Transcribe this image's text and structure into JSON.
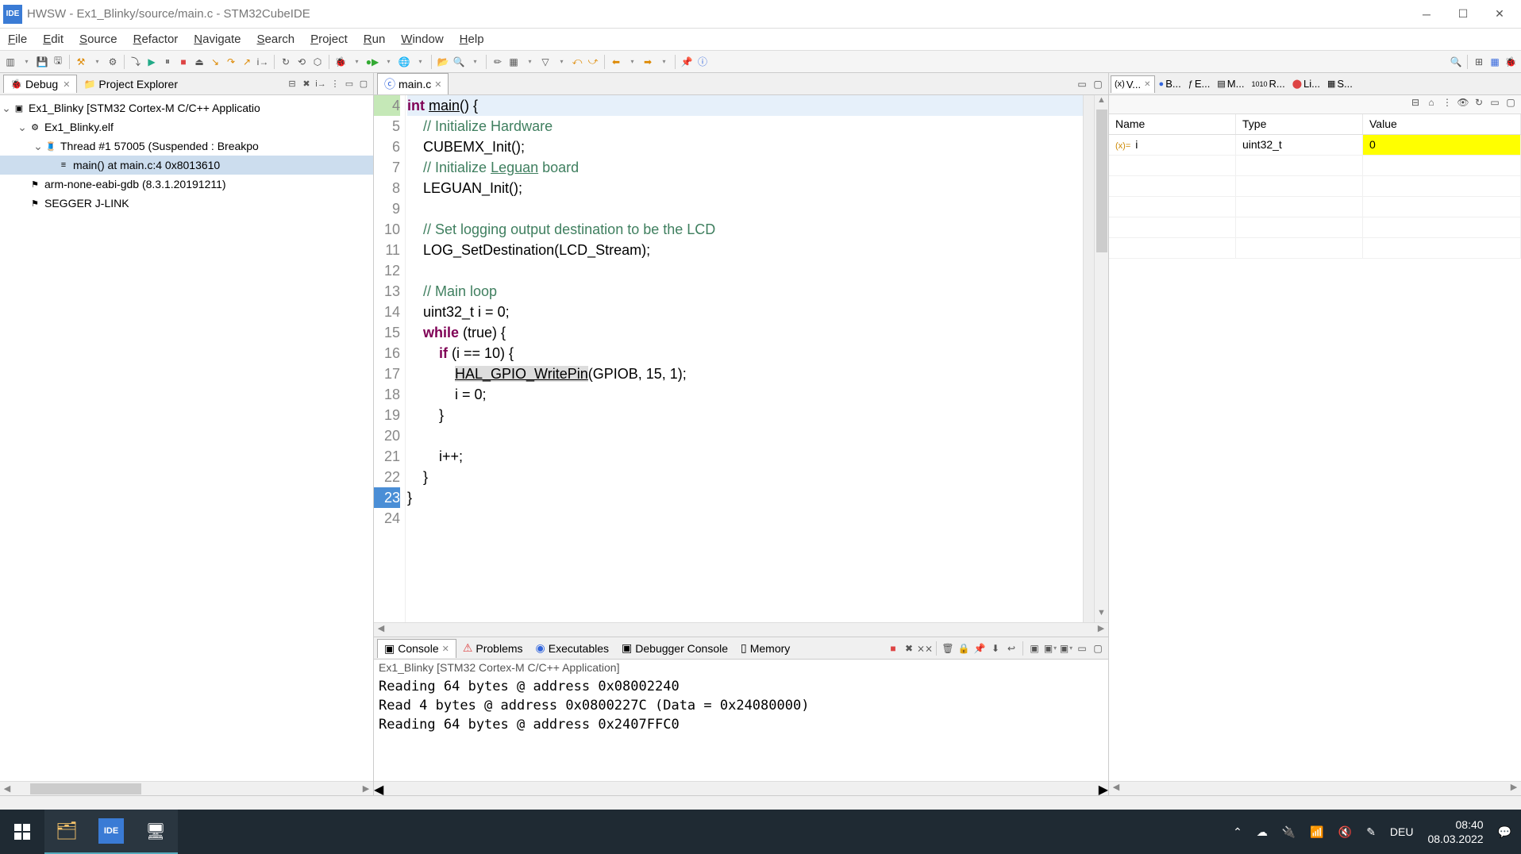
{
  "window": {
    "title": "HWSW - Ex1_Blinky/source/main.c - STM32CubeIDE",
    "logo": "IDE"
  },
  "menu": [
    "File",
    "Edit",
    "Source",
    "Refactor",
    "Navigate",
    "Search",
    "Project",
    "Run",
    "Window",
    "Help"
  ],
  "debug_panel": {
    "tabs": {
      "debug": "Debug",
      "explorer": "Project Explorer"
    },
    "tree": {
      "root": "Ex1_Blinky [STM32 Cortex-M C/C++ Applicatio",
      "elf": "Ex1_Blinky.elf",
      "thread": "Thread #1 57005 (Suspended : Breakpo",
      "frame": "main() at main.c:4 0x8013610",
      "gdb": "arm-none-eabi-gdb (8.3.1.20191211)",
      "jlink": "SEGGER J-LINK"
    }
  },
  "editor": {
    "tab": "main.c",
    "lines": [
      {
        "n": 4,
        "cls": "hl",
        "html": "<span class='curline'><span class='kw'>int</span> <span class='underline'>main</span>() {</span>"
      },
      {
        "n": 5,
        "cls": "",
        "html": "    <span class='cm'>// Initialize Hardware</span>"
      },
      {
        "n": 6,
        "cls": "",
        "html": "    CUBEMX_Init();"
      },
      {
        "n": 7,
        "cls": "",
        "html": "    <span class='cm'>// Initialize <span class='underline'>Leguan</span> board</span>"
      },
      {
        "n": 8,
        "cls": "",
        "html": "    LEGUAN_Init();"
      },
      {
        "n": 9,
        "cls": "",
        "html": ""
      },
      {
        "n": 10,
        "cls": "",
        "html": "    <span class='cm'>// Set logging output destination to be the LCD</span>"
      },
      {
        "n": 11,
        "cls": "",
        "html": "    LOG_SetDestination(LCD_Stream);"
      },
      {
        "n": 12,
        "cls": "",
        "html": ""
      },
      {
        "n": 13,
        "cls": "",
        "html": "    <span class='cm'>// Main loop</span>"
      },
      {
        "n": 14,
        "cls": "",
        "html": "    uint32_t i = 0;"
      },
      {
        "n": 15,
        "cls": "",
        "html": "    <span class='kw'>while</span> (true) {"
      },
      {
        "n": 16,
        "cls": "",
        "html": "        <span class='kw'>if</span> (i == 10) {"
      },
      {
        "n": 17,
        "cls": "",
        "html": "            <span class='highlight-call underline'>HAL_GPIO_WritePin</span>(GPIOB, 15, 1);"
      },
      {
        "n": 18,
        "cls": "",
        "html": "            i = 0;"
      },
      {
        "n": 19,
        "cls": "",
        "html": "        }"
      },
      {
        "n": 20,
        "cls": "",
        "html": ""
      },
      {
        "n": 21,
        "cls": "",
        "html": "        i++;"
      },
      {
        "n": 22,
        "cls": "",
        "html": "    }"
      },
      {
        "n": 23,
        "cls": "bp",
        "html": "}"
      },
      {
        "n": 24,
        "cls": "",
        "html": ""
      }
    ]
  },
  "variables": {
    "tabs": [
      "V...",
      "B...",
      "E...",
      "M...",
      "R...",
      "Li...",
      "S..."
    ],
    "headers": {
      "name": "Name",
      "type": "Type",
      "value": "Value"
    },
    "rows": [
      {
        "name": "i",
        "type": "uint32_t",
        "value": "0"
      }
    ]
  },
  "console": {
    "tabs": {
      "console": "Console",
      "problems": "Problems",
      "executables": "Executables",
      "debugger": "Debugger Console",
      "memory": "Memory"
    },
    "subtitle": "Ex1_Blinky [STM32 Cortex-M C/C++ Application]",
    "lines": [
      "Reading 64 bytes @ address 0x08002240",
      "Read 4 bytes @ address 0x0800227C (Data = 0x24080000)",
      "Reading 64 bytes @ address 0x2407FFC0"
    ]
  },
  "taskbar": {
    "lang": "DEU",
    "time": "08:40",
    "date": "08.03.2022"
  }
}
